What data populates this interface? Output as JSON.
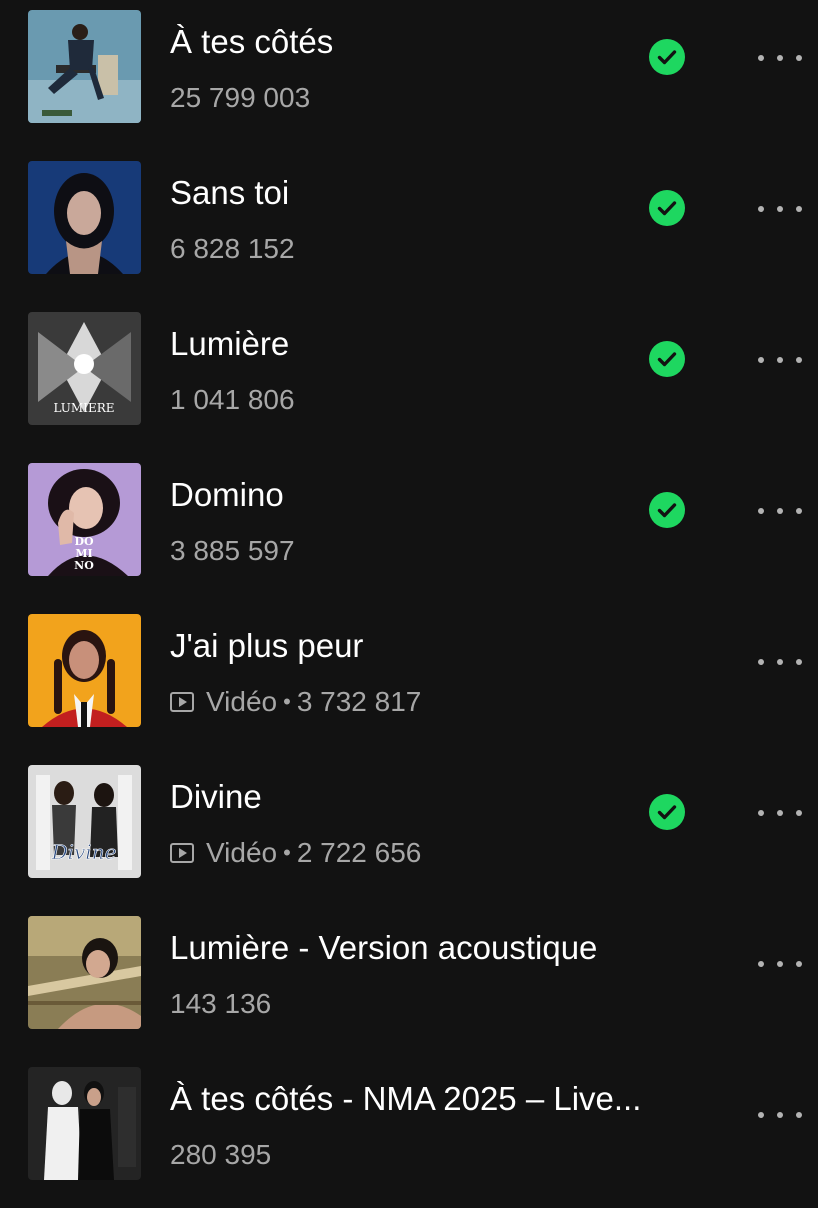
{
  "tracks": [
    {
      "title": "À tes côtés",
      "is_video": false,
      "video_label": "",
      "plays": "25 799 003",
      "downloaded": true,
      "cover_color": "#6a9ab0",
      "cover_icon": "man-on-chair-cover"
    },
    {
      "title": "Sans toi",
      "is_video": false,
      "video_label": "",
      "plays": "6 828 152",
      "downloaded": true,
      "cover_color": "#1a3d7a",
      "cover_icon": "woman-portrait-blue-cover"
    },
    {
      "title": "Lumière",
      "is_video": false,
      "video_label": "",
      "plays": "1 041 806",
      "downloaded": true,
      "cover_color": "#4a4a4a",
      "cover_icon": "lumiere-mono-cover",
      "cover_text": "LUMIERE"
    },
    {
      "title": "Domino",
      "is_video": false,
      "video_label": "",
      "plays": "3 885 597",
      "downloaded": true,
      "cover_color": "#b08ad8",
      "cover_icon": "domino-portrait-cover",
      "cover_text": "DO MI NO"
    },
    {
      "title": "J'ai plus peur",
      "is_video": true,
      "video_label": "Vidéo",
      "plays": "3 732 817",
      "downloaded": false,
      "cover_color": "#f0a020",
      "cover_icon": "braids-portrait-cover"
    },
    {
      "title": "Divine",
      "is_video": true,
      "video_label": "Vidéo",
      "plays": "2 722 656",
      "downloaded": true,
      "cover_color": "#d8d8d8",
      "cover_icon": "divine-cover",
      "cover_text": "Divine"
    },
    {
      "title": "Lumière - Version acoustique",
      "is_video": false,
      "video_label": "",
      "plays": "143 136",
      "downloaded": false,
      "cover_color": "#8a7a50",
      "cover_icon": "acoustic-portrait-cover"
    },
    {
      "title": "À tes côtés - NMA 2025 – Live...",
      "is_video": false,
      "video_label": "",
      "plays": "280 395",
      "downloaded": false,
      "cover_color": "#2a2a2a",
      "cover_icon": "duo-live-cover"
    }
  ],
  "colors": {
    "background": "#121212",
    "title": "#ffffff",
    "meta": "#a7a7a7",
    "accent": "#1ed760"
  }
}
